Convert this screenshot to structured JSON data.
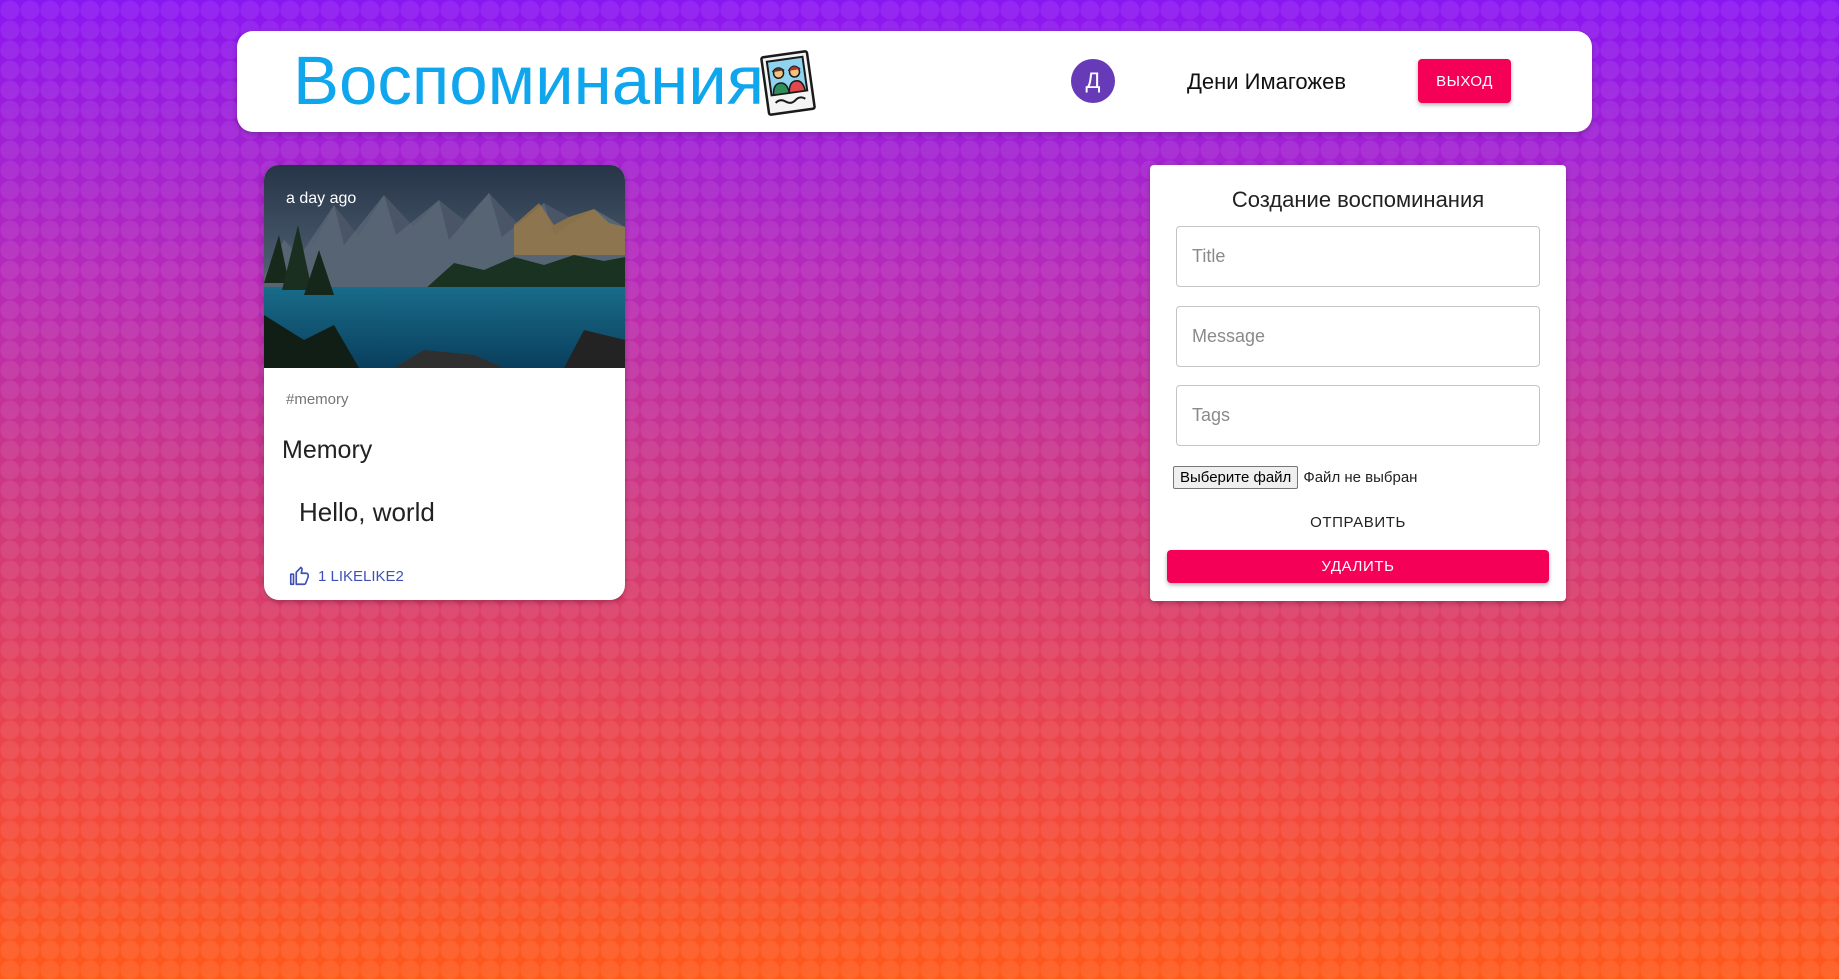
{
  "header": {
    "brand_title": "Воспоминания",
    "brand_icon": "memories-photo-icon",
    "avatar_initial": "Д",
    "username": "Дени Имагожев",
    "logout_label": "ВЫХОД"
  },
  "post": {
    "time_ago": "a day ago",
    "tags": "#memory",
    "title": "Memory",
    "message": "Hello, world",
    "like_label": "1 LIKELIKE2",
    "image": "mountain-lake-photo"
  },
  "form": {
    "heading": "Создание воспоминания",
    "title_placeholder": "Title",
    "message_placeholder": "Message",
    "tags_placeholder": "Tags",
    "file_button_label": "Выберите файл",
    "file_status": "Файл не выбран",
    "submit_label": "ОТПРАВИТЬ",
    "clear_label": "УДАЛИТЬ"
  },
  "colors": {
    "brand": "#0fa6ee",
    "avatar": "#673ab7",
    "secondary": "#f50057",
    "primary_text": "#3f51b5",
    "background_top": "#8a16f2",
    "background_bottom": "#ff5a1a"
  }
}
